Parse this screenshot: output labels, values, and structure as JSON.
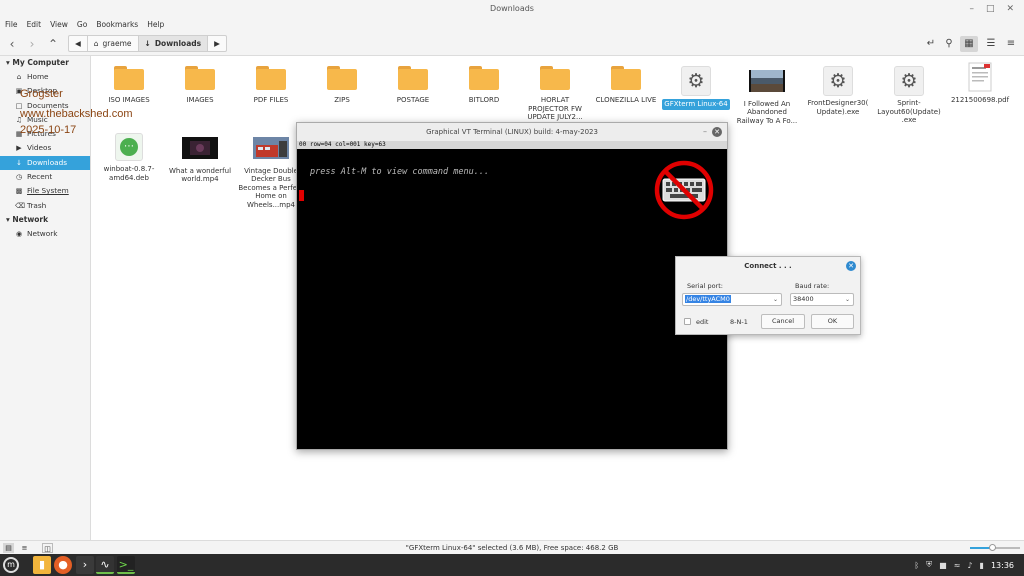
{
  "window": {
    "title": "Downloads"
  },
  "menubar": [
    "File",
    "Edit",
    "View",
    "Go",
    "Bookmarks",
    "Help"
  ],
  "breadcrumbs": [
    "graeme",
    "Downloads"
  ],
  "sidebar": {
    "my_computer": "My Computer",
    "items": [
      "Home",
      "Desktop",
      "Documents",
      "Music",
      "Pictures",
      "Videos",
      "Downloads",
      "Recent",
      "File System",
      "Trash"
    ],
    "network_header": "Network",
    "network_items": [
      "Network"
    ]
  },
  "files_row1": [
    {
      "label": "ISO IMAGES",
      "kind": "folder"
    },
    {
      "label": "IMAGES",
      "kind": "folder"
    },
    {
      "label": "PDF FILES",
      "kind": "folder"
    },
    {
      "label": "ZIPS",
      "kind": "folder"
    },
    {
      "label": "POSTAGE",
      "kind": "folder"
    },
    {
      "label": "BITLORD",
      "kind": "folder"
    },
    {
      "label": "HORLAT PROJECTOR FW UPDATE JULY2...",
      "kind": "folder"
    },
    {
      "label": "CLONEZILLA LIVE",
      "kind": "folder"
    },
    {
      "label": "GFXterm Linux-64",
      "kind": "executable"
    },
    {
      "label": "I Followed An Abandoned Railway To A Fo...",
      "kind": "video"
    },
    {
      "label": "FrontDesigner30( Update).exe",
      "kind": "executable"
    },
    {
      "label": "Sprint-Layout60(Update) .exe",
      "kind": "executable"
    },
    {
      "label": "2121500698.pdf",
      "kind": "pdf"
    }
  ],
  "files_row2": [
    {
      "label": "winboat-0.8.7-amd64.deb",
      "kind": "package"
    },
    {
      "label": "What a wonderful world.mp4",
      "kind": "video"
    },
    {
      "label": "Vintage Double Decker Bus Becomes a Perfect Home on Wheels...mp4",
      "kind": "video"
    }
  ],
  "watermark": {
    "line1": "Grogster",
    "line2": "www.thebackshed.com",
    "line3": "2025-10-17"
  },
  "terminal": {
    "title": "Graphical VT Terminal (LINUX)  build: 4-may-2023",
    "status": "00 row=04 col=001 key=63",
    "message": "press Alt-M to view command menu..."
  },
  "dialog": {
    "title": "Connect . . .",
    "serial_label": "Serial port:",
    "serial_value": "/dev/ttyACM0",
    "baud_label": "Baud rate:",
    "baud_value": "38400",
    "edit_label": "edit",
    "format": "8-N-1",
    "cancel": "Cancel",
    "ok": "OK"
  },
  "status": "\"GFXterm Linux-64\" selected (3.6 MB), Free space: 468.2 GB",
  "taskbar": {
    "time": "13:36"
  },
  "colors": {
    "accent": "#35a2db",
    "folder": "#f7b84b",
    "no_symbol": "#e00000"
  }
}
